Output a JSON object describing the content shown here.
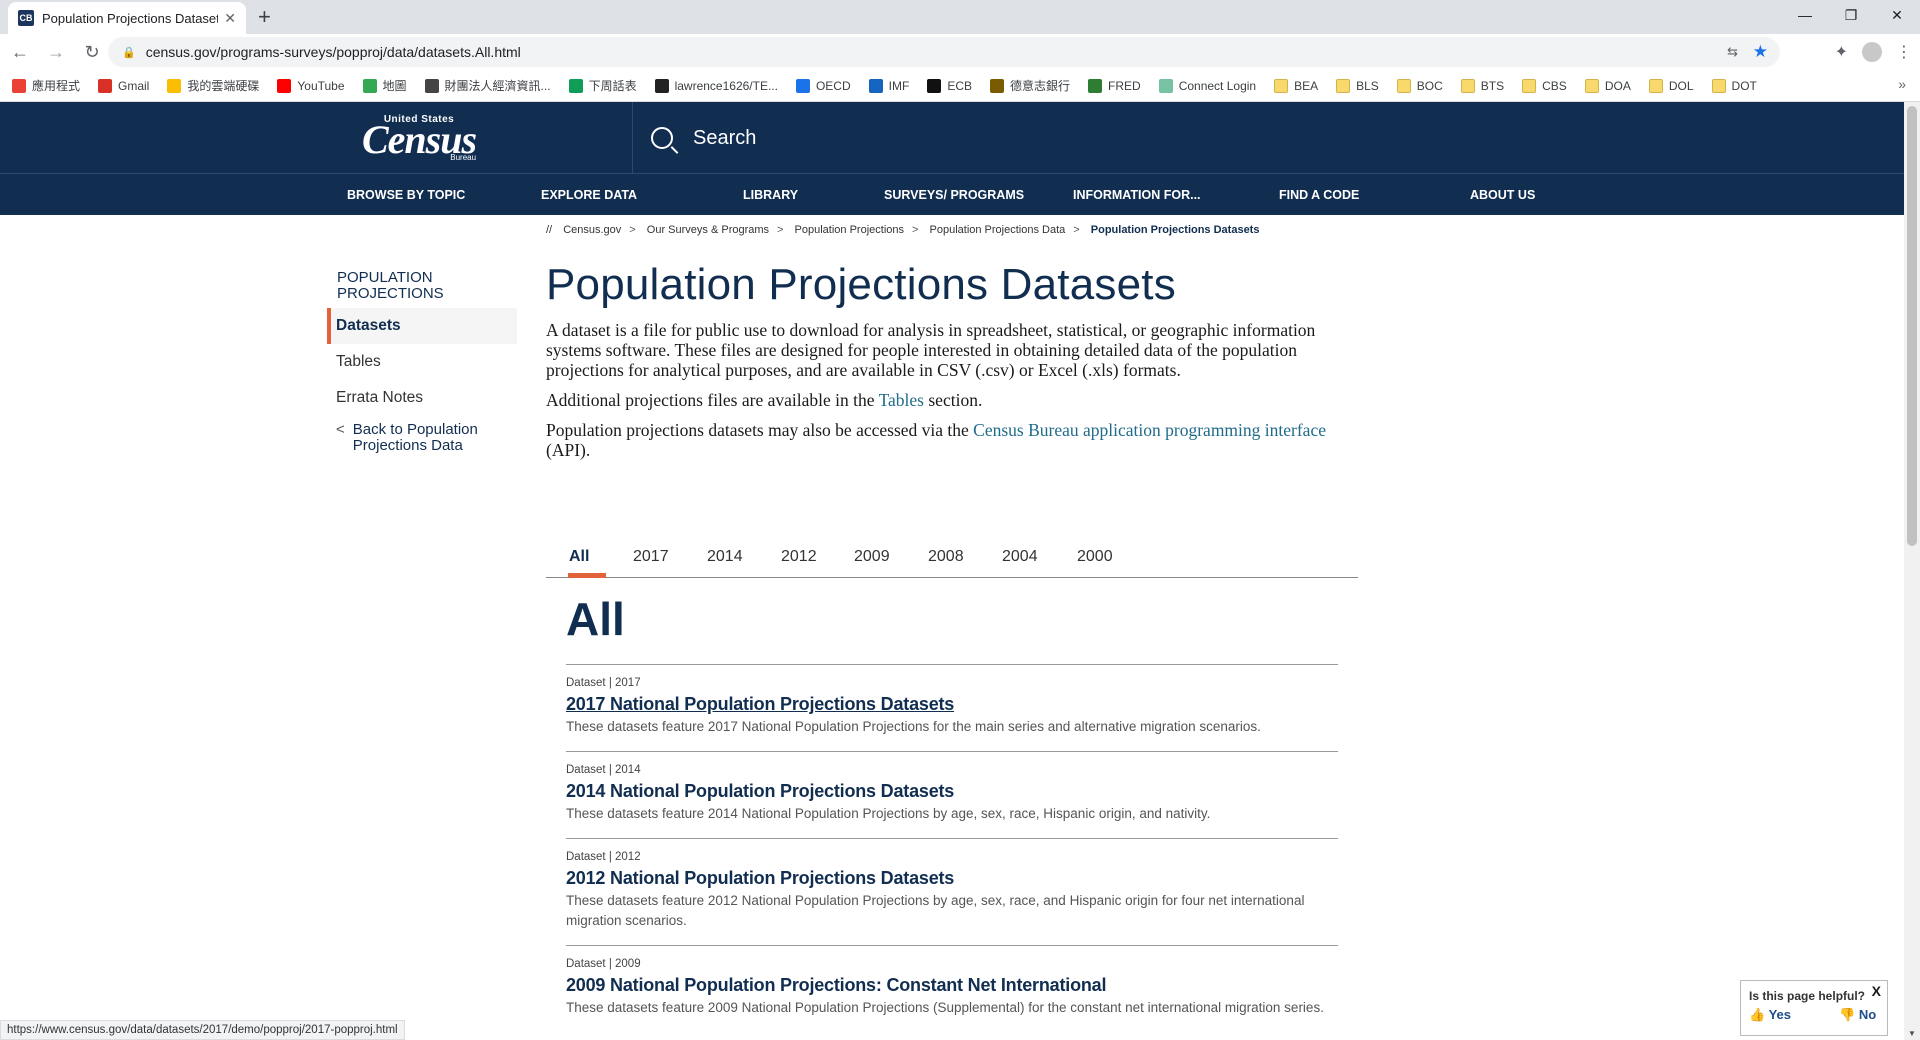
{
  "browser": {
    "tab_title": "Population Projections Datasets",
    "tab_favicon": "CB",
    "url": "census.gov/programs-surveys/popproj/data/datasets.All.html",
    "status_url": "https://www.census.gov/data/datasets/2017/demo/popproj/2017-popproj.html"
  },
  "bookmarks": [
    "應用程式",
    "Gmail",
    "我的雲端硬碟",
    "YouTube",
    "地圖",
    "財團法人經濟資訊...",
    "下周話表",
    "lawrence1626/TE...",
    "OECD",
    "IMF",
    "ECB",
    "德意志銀行",
    "FRED",
    "Connect Login",
    "BEA",
    "BLS",
    "BOC",
    "BTS",
    "CBS",
    "DOA",
    "DOL",
    "DOT"
  ],
  "header": {
    "logo_top": "United States",
    "logo_main": "Census",
    "logo_bottom": "Bureau",
    "search_label": "Search"
  },
  "nav": [
    "BROWSE BY TOPIC",
    "EXPLORE DATA",
    "LIBRARY",
    "SURVEYS/ PROGRAMS",
    "INFORMATION FOR...",
    "FIND A CODE",
    "ABOUT US"
  ],
  "breadcrumb": {
    "prefix": "//",
    "items": [
      "Census.gov",
      "Our Surveys & Programs",
      "Population Projections",
      "Population Projections Data"
    ],
    "current": "Population Projections Datasets"
  },
  "sidebar": {
    "heading": "POPULATION PROJECTIONS",
    "items": [
      "Datasets",
      "Tables",
      "Errata Notes"
    ],
    "back": "Back to Population Projections Data"
  },
  "main": {
    "title": "Population Projections Datasets",
    "p1": "A dataset is a file for public use to download for analysis in spreadsheet, statistical, or geographic information systems software. These files are designed for people interested in obtaining detailed data of the population projections for analytical purposes, and are available in CSV (.csv) or Excel (.xls) formats.",
    "p2_pre": "Additional projections files are available in the ",
    "p2_link": "Tables",
    "p2_post": " section.",
    "p3_pre": "Population projections datasets may also be accessed via the ",
    "p3_link": "Census Bureau application programming interface",
    "p3_post": " (API)."
  },
  "tabs": [
    "All",
    "2017",
    "2014",
    "2012",
    "2009",
    "2008",
    "2004",
    "2000"
  ],
  "section_heading": "All",
  "datasets": [
    {
      "meta": "Dataset | 2017",
      "title": "2017 National Population Projections Datasets",
      "desc": "These datasets feature 2017 National Population Projections for the main series and alternative migration scenarios."
    },
    {
      "meta": "Dataset | 2014",
      "title": "2014 National Population Projections Datasets",
      "desc": "These datasets feature 2014 National Population Projections by age, sex, race, Hispanic origin, and nativity."
    },
    {
      "meta": "Dataset | 2012",
      "title": "2012 National Population Projections Datasets",
      "desc": "These datasets feature 2012 National Population Projections by age, sex, race, and Hispanic origin for four net international migration scenarios."
    },
    {
      "meta": "Dataset | 2009",
      "title": "2009 National Population Projections: Constant Net International",
      "desc": "These datasets feature 2009 National Population Projections (Supplemental) for the constant net international migration series."
    }
  ],
  "feedback": {
    "question": "Is this page helpful?",
    "yes": "Yes",
    "no": "No",
    "close": "X"
  },
  "colors": {
    "navy": "#112e51",
    "accent": "#e2633a",
    "link": "#1f6b8a"
  }
}
